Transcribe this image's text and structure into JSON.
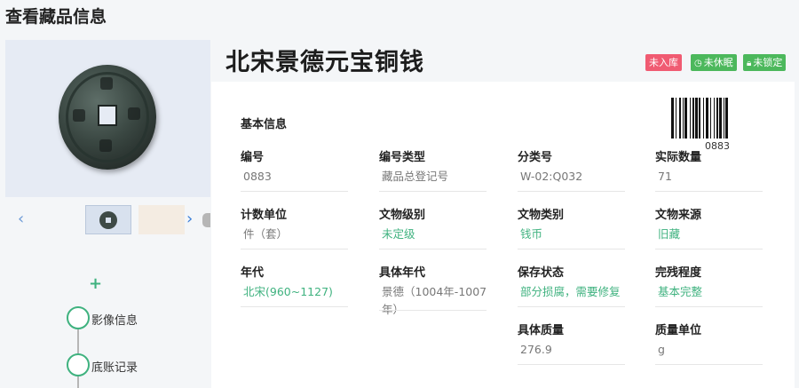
{
  "page": {
    "title": "查看藏品信息"
  },
  "gallery": {
    "prev_icon": "chevron-left-icon",
    "next_icon": "chevron-right-icon"
  },
  "sidebar": {
    "add_icon": "plus-icon",
    "add_symbol": "+",
    "timeline": [
      {
        "label": "影像信息"
      },
      {
        "label": "底账记录"
      }
    ]
  },
  "item": {
    "name": "北宋景德元宝铜钱",
    "badges": [
      {
        "label": "未入库",
        "color": "#f05b72",
        "icon": ""
      },
      {
        "label": "未休眠",
        "color": "#4cb85c",
        "icon": "clock-icon"
      },
      {
        "label": "未锁定",
        "color": "#4cb85c",
        "icon": "lock-icon"
      }
    ]
  },
  "basic_info": {
    "title": "基本信息",
    "barcode_number": "0883",
    "fields": [
      {
        "label": "编号",
        "value": "0883"
      },
      {
        "label": "编号类型",
        "value": "藏品总登记号"
      },
      {
        "label": "分类号",
        "value": "W-02:Q032"
      },
      {
        "label": "实际数量",
        "value": "71"
      },
      {
        "label": "计数单位",
        "value": "件（套）"
      },
      {
        "label": "文物级别",
        "value": "未定级"
      },
      {
        "label": "文物类别",
        "value": "钱币"
      },
      {
        "label": "文物来源",
        "value": "旧藏"
      },
      {
        "label": "年代",
        "value": "北宋(960~1127)"
      },
      {
        "label": "具体年代",
        "value": "景德（1004年-1007年）"
      },
      {
        "label": "保存状态",
        "value": "部分损腐，需要修复"
      },
      {
        "label": "完残程度",
        "value": "基本完整"
      },
      {
        "label": "具体质量",
        "value": "276.9"
      },
      {
        "label": "质量单位",
        "value": "g"
      }
    ]
  },
  "colors": {
    "accent_green": "#3fb27f",
    "badge_red": "#f05b72",
    "badge_green": "#4cb85c",
    "link_blue": "#3b7fd9"
  }
}
